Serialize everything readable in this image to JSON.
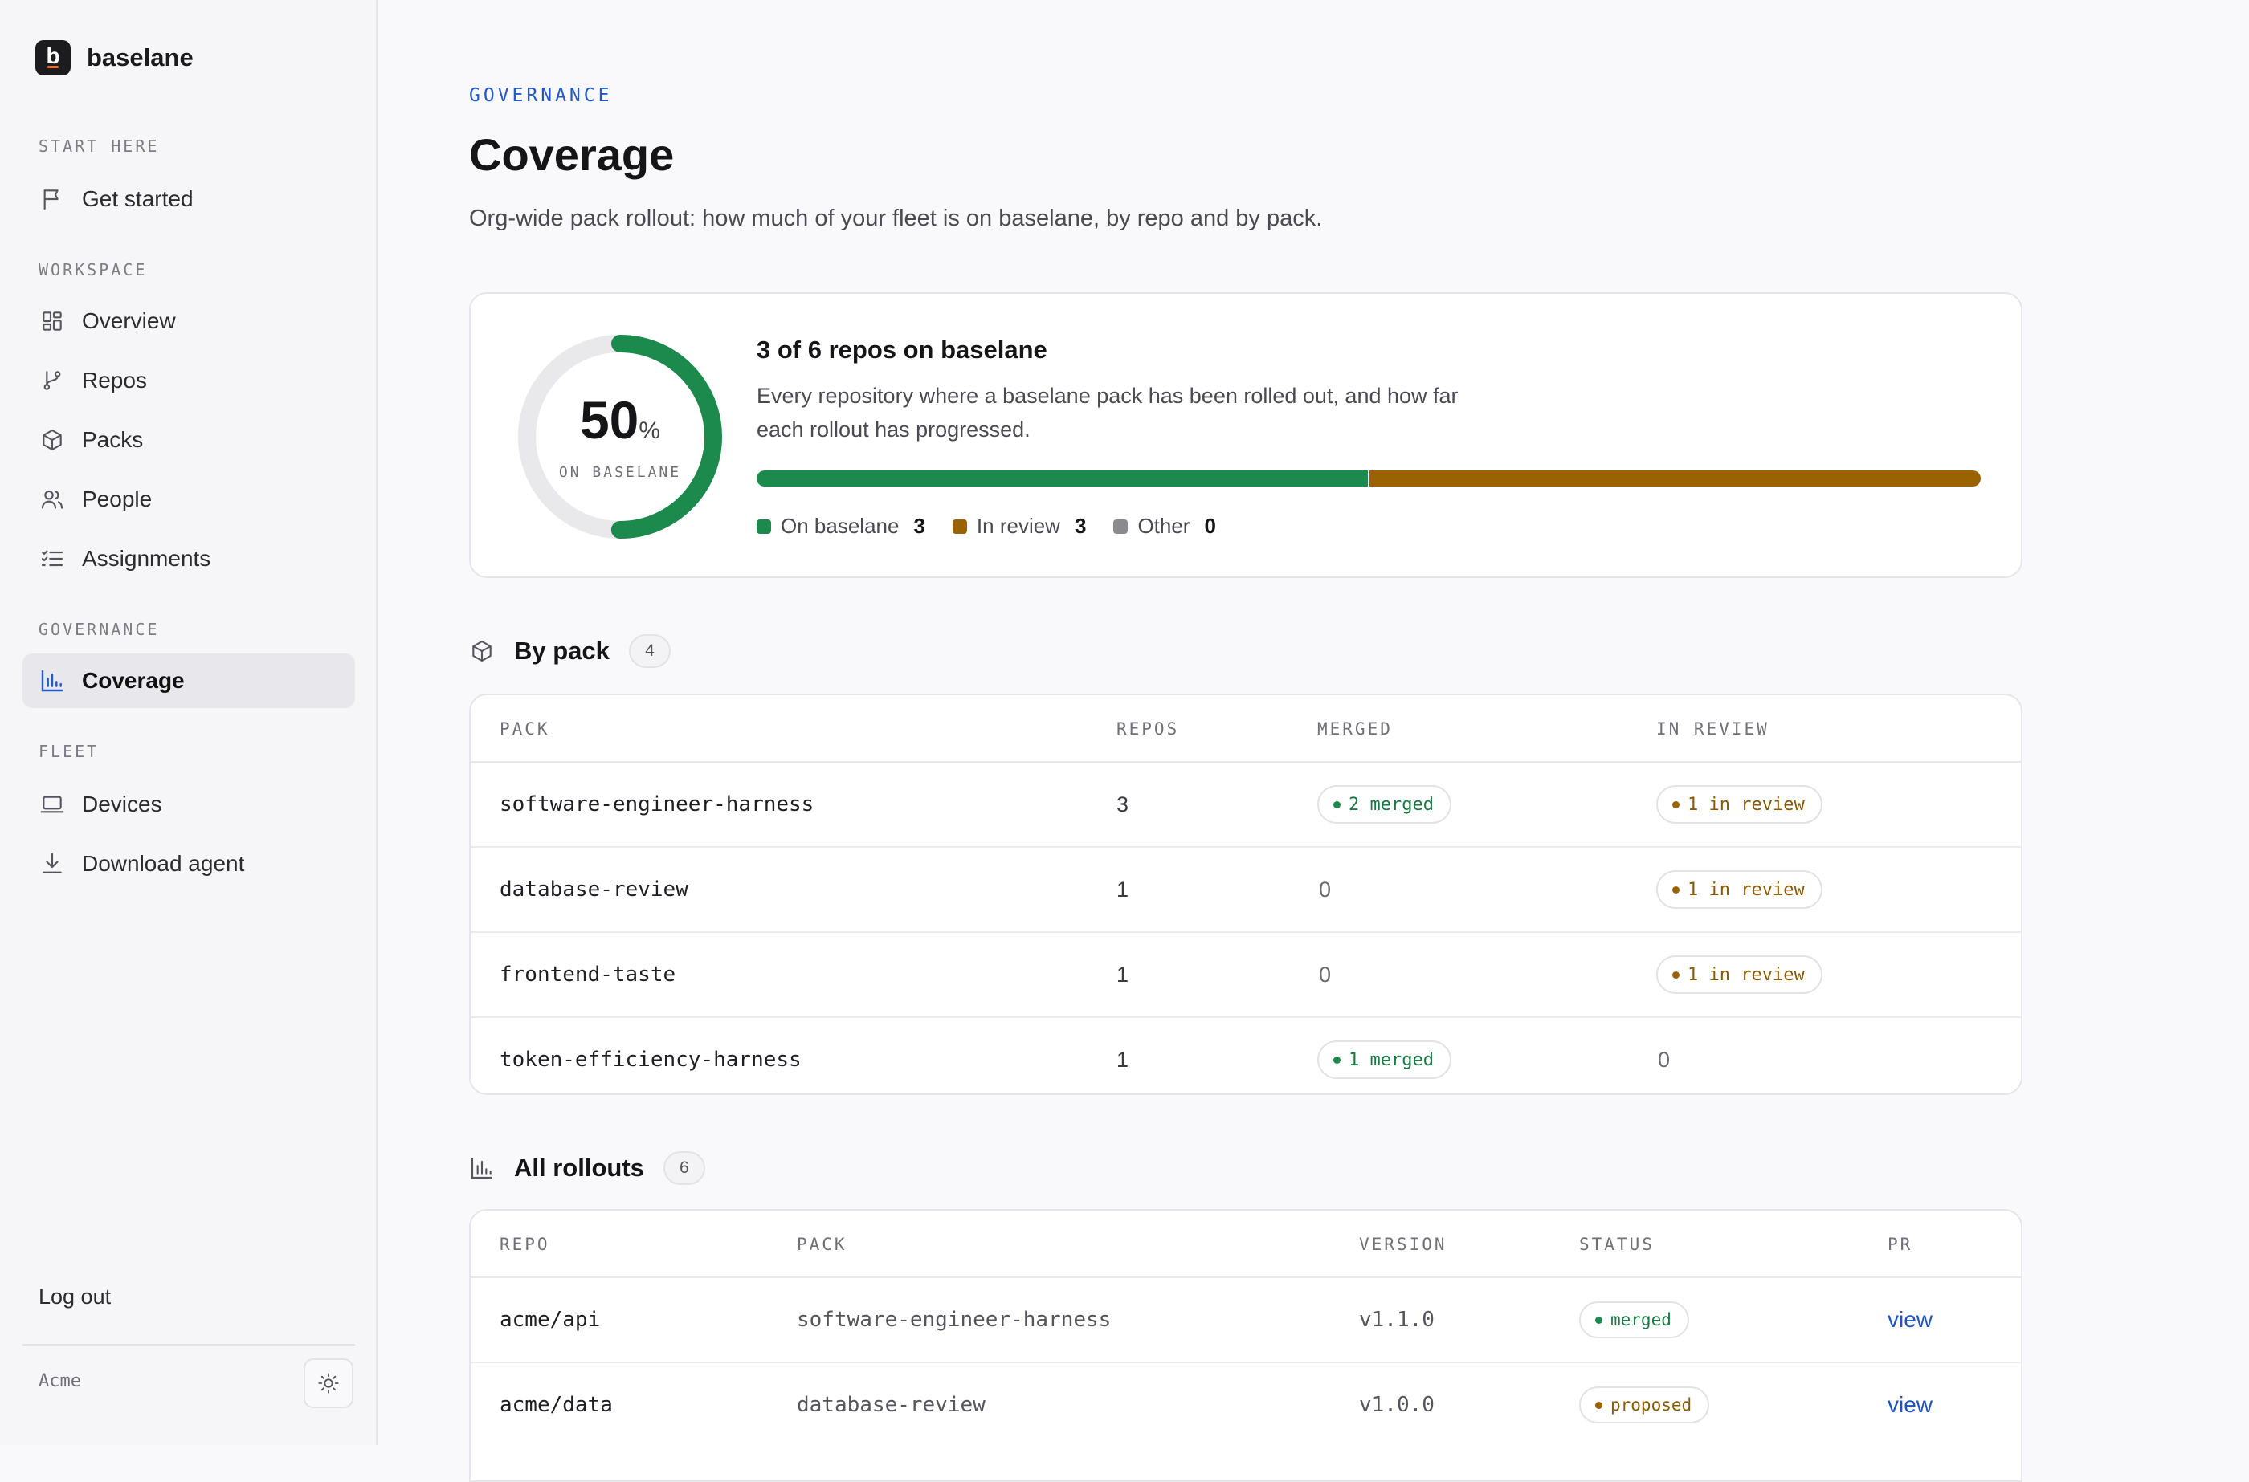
{
  "brand": {
    "logo_letter": "b",
    "name": "baselane"
  },
  "sidebar": {
    "sections": [
      {
        "label": "START HERE"
      },
      {
        "label": "WORKSPACE"
      },
      {
        "label": "GOVERNANCE"
      },
      {
        "label": "FLEET"
      }
    ],
    "items": [
      {
        "label": "Get started",
        "icon": "flag-icon"
      },
      {
        "label": "Overview",
        "icon": "grid-icon"
      },
      {
        "label": "Repos",
        "icon": "git-branch-icon"
      },
      {
        "label": "Packs",
        "icon": "box-icon"
      },
      {
        "label": "People",
        "icon": "users-icon"
      },
      {
        "label": "Assignments",
        "icon": "list-checks-icon"
      },
      {
        "label": "Coverage",
        "icon": "bar-chart-icon",
        "active": true
      },
      {
        "label": "Devices",
        "icon": "laptop-icon"
      },
      {
        "label": "Download agent",
        "icon": "download-icon"
      }
    ],
    "logout_label": "Log out",
    "org_name": "Acme",
    "theme_icon": "sun-icon"
  },
  "header": {
    "eyebrow": "GOVERNANCE",
    "title": "Coverage",
    "description": "Org-wide pack rollout: how much of your fleet is on baselane, by repo and by pack."
  },
  "summary": {
    "percent": "50",
    "percent_sign": "%",
    "percent_value": 50,
    "caption": "ON BASELANE",
    "title": "3 of 6 repos on baselane",
    "description": "Every repository where a baselane pack has been rolled out, and how far each rollout has progressed.",
    "legend": [
      {
        "label": "On baselane",
        "count": "3",
        "value": 3,
        "color": "#1b8a4c"
      },
      {
        "label": "In review",
        "count": "3",
        "value": 3,
        "color": "#9a6200"
      },
      {
        "label": "Other",
        "count": "0",
        "value": 0,
        "color": "#8a8a90"
      }
    ],
    "track_color": "#e9e9ec"
  },
  "by_pack": {
    "title": "By pack",
    "count": "4",
    "columns": [
      "PACK",
      "REPOS",
      "MERGED",
      "IN REVIEW"
    ],
    "rows": [
      {
        "pack": "software-engineer-harness",
        "repos": "3",
        "merged": "2 merged",
        "in_review": "1 in review"
      },
      {
        "pack": "database-review",
        "repos": "1",
        "merged": "0",
        "in_review": "1 in review"
      },
      {
        "pack": "frontend-taste",
        "repos": "1",
        "merged": "0",
        "in_review": "1 in review"
      },
      {
        "pack": "token-efficiency-harness",
        "repos": "1",
        "merged": "1 merged",
        "in_review": "0"
      }
    ]
  },
  "all_rollouts": {
    "title": "All rollouts",
    "count": "6",
    "columns": [
      "REPO",
      "PACK",
      "VERSION",
      "STATUS",
      "PR"
    ],
    "rows": [
      {
        "repo": "acme/api",
        "pack": "software-engineer-harness",
        "version": "v1.1.0",
        "status": "merged",
        "pr": "view"
      },
      {
        "repo": "acme/data",
        "pack": "database-review",
        "version": "v1.0.0",
        "status": "proposed",
        "pr": "view"
      }
    ]
  },
  "colors": {
    "accent": "#2458c6",
    "green": "#1b8a4c",
    "amber": "#9a6200"
  }
}
